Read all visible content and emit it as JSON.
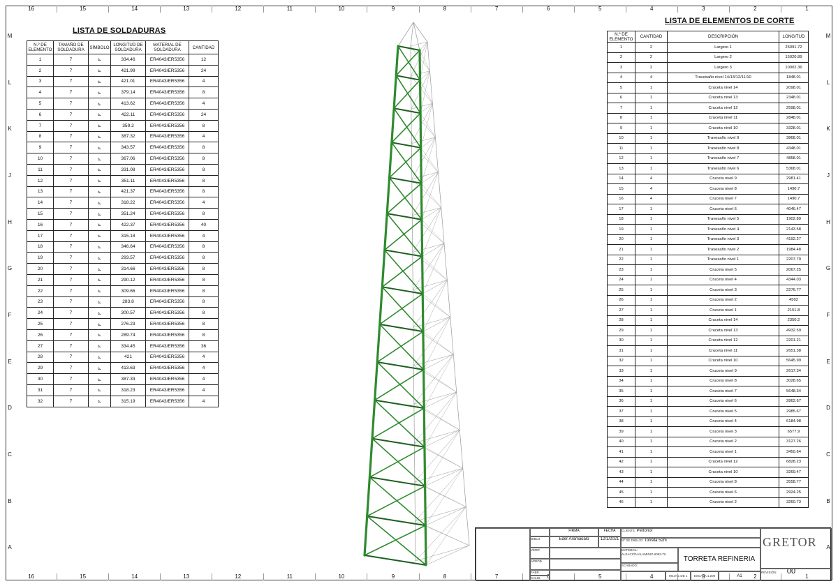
{
  "zones_top": [
    "16",
    "15",
    "14",
    "13",
    "12",
    "11",
    "10",
    "9",
    "8",
    "7",
    "6",
    "5",
    "4",
    "3",
    "2",
    "1"
  ],
  "zones_side": [
    "M",
    "L",
    "K",
    "J",
    "H",
    "G",
    "F",
    "E",
    "D",
    "C",
    "B",
    "A"
  ],
  "weld_list": {
    "title": "LISTA DE SOLDADURAS",
    "headers": [
      "N.º DE ELEMENTO",
      "TAMAÑO DE SOLDADURA",
      "SÍMBOLO",
      "LONGITUD DE SOLDADURA",
      "MATERIAL DE SOLDADURA",
      "CANTIDAD"
    ],
    "symbol": "⊾",
    "rows": [
      [
        "1",
        "7",
        "334.46",
        "ER4043/ER5356",
        "12"
      ],
      [
        "2",
        "7",
        "421.99",
        "ER4043/ER5356",
        "24"
      ],
      [
        "3",
        "7",
        "421.01",
        "ER4043/ER5356",
        "4"
      ],
      [
        "4",
        "7",
        "379.14",
        "ER4043/ER5356",
        "8"
      ],
      [
        "5",
        "7",
        "413.62",
        "ER4043/ER5356",
        "4"
      ],
      [
        "6",
        "7",
        "422.11",
        "ER4043/ER5356",
        "24"
      ],
      [
        "7",
        "7",
        "359.2",
        "ER4043/ER5356",
        "8"
      ],
      [
        "8",
        "7",
        "387.32",
        "ER4043/ER5356",
        "4"
      ],
      [
        "9",
        "7",
        "343.57",
        "ER4043/ER5356",
        "8"
      ],
      [
        "10",
        "7",
        "367.06",
        "ER4043/ER5356",
        "8"
      ],
      [
        "11",
        "7",
        "331.08",
        "ER4043/ER5356",
        "8"
      ],
      [
        "12",
        "7",
        "351.11",
        "ER4043/ER5356",
        "8"
      ],
      [
        "13",
        "7",
        "421.37",
        "ER4043/ER5356",
        "8"
      ],
      [
        "14",
        "7",
        "318.22",
        "ER4043/ER5356",
        "4"
      ],
      [
        "15",
        "7",
        "351.24",
        "ER4043/ER5356",
        "8"
      ],
      [
        "16",
        "7",
        "422.37",
        "ER4043/ER5356",
        "40"
      ],
      [
        "17",
        "7",
        "315.18",
        "ER4043/ER5356",
        "4"
      ],
      [
        "18",
        "7",
        "346.64",
        "ER4043/ER5356",
        "8"
      ],
      [
        "19",
        "7",
        "293.57",
        "ER4043/ER5356",
        "8"
      ],
      [
        "20",
        "7",
        "314.66",
        "ER4043/ER5356",
        "8"
      ],
      [
        "21",
        "7",
        "290.12",
        "ER4043/ER5356",
        "8"
      ],
      [
        "22",
        "7",
        "309.66",
        "ER4043/ER5356",
        "8"
      ],
      [
        "23",
        "7",
        "283.8",
        "ER4043/ER5356",
        "8"
      ],
      [
        "24",
        "7",
        "300.57",
        "ER4043/ER5356",
        "8"
      ],
      [
        "25",
        "7",
        "276.23",
        "ER4043/ER5356",
        "8"
      ],
      [
        "26",
        "7",
        "289.74",
        "ER4043/ER5356",
        "8"
      ],
      [
        "27",
        "7",
        "334.45",
        "ER4043/ER5356",
        "36"
      ],
      [
        "28",
        "7",
        "421",
        "ER4043/ER5356",
        "4"
      ],
      [
        "29",
        "7",
        "413.63",
        "ER4043/ER5356",
        "4"
      ],
      [
        "30",
        "7",
        "387.33",
        "ER4043/ER5356",
        "4"
      ],
      [
        "31",
        "7",
        "318.23",
        "ER4043/ER5356",
        "4"
      ],
      [
        "32",
        "7",
        "315.19",
        "ER4043/ER5356",
        "4"
      ]
    ]
  },
  "cut_list": {
    "title": "LISTA DE ELEMENTOS DE CORTE",
    "headers": [
      "N.º DE ELEMENTO",
      "CANTIDAD",
      "DESCRIPCIÓN",
      "LONGITUD"
    ],
    "rows": [
      [
        "1",
        "2",
        "Largero 1",
        "25091.72"
      ],
      [
        "2",
        "2",
        "Largero 2",
        "15020.89"
      ],
      [
        "3",
        "2",
        "Largero 3",
        "10002.36"
      ],
      [
        "4",
        "4",
        "Travesaño nivel 14/13/12/11/10",
        "1848.01"
      ],
      [
        "5",
        "1",
        "Cruceta nivel 14",
        "2098.01"
      ],
      [
        "6",
        "1",
        "Cruceta nivel 13",
        "2348.01"
      ],
      [
        "7",
        "1",
        "Cruceta nivel 12",
        "2598.01"
      ],
      [
        "8",
        "1",
        "Cruceta nivel 11",
        "2848.01"
      ],
      [
        "9",
        "1",
        "Cruceta nivel 10",
        "3328.01"
      ],
      [
        "10",
        "1",
        "Travesaño nivel 9",
        "3868.01"
      ],
      [
        "11",
        "1",
        "Travesaño nivel 8",
        "4348.01"
      ],
      [
        "12",
        "1",
        "Travesaño nivel 7",
        "4858.01"
      ],
      [
        "13",
        "1",
        "Travesaño nivel 6",
        "5368.01"
      ],
      [
        "14",
        "4",
        "Cruceta nivel 9",
        "2981.41"
      ],
      [
        "15",
        "4",
        "Cruceta nivel 8",
        "1490.7"
      ],
      [
        "16",
        "4",
        "Cruceta nivel 7",
        "1490.7"
      ],
      [
        "17",
        "1",
        "Cruceta nivel 6",
        "4046.47"
      ],
      [
        "18",
        "1",
        "Travesaño nivel 5",
        "1902.89"
      ],
      [
        "19",
        "1",
        "Travesaño nivel 4",
        "2143.58"
      ],
      [
        "20",
        "1",
        "Travesaño nivel 3",
        "4192.27"
      ],
      [
        "21",
        "1",
        "Travesaño nivel 2",
        "1984.48"
      ],
      [
        "22",
        "1",
        "Travesaño nivel 1",
        "2207.79"
      ],
      [
        "23",
        "1",
        "Cruceta nivel 5",
        "2067.25"
      ],
      [
        "24",
        "1",
        "Cruceta nivel 4",
        "4344.03"
      ],
      [
        "25",
        "1",
        "Cruceta nivel 3",
        "2276.77"
      ],
      [
        "26",
        "1",
        "Cruceta nivel 2",
        "4502"
      ],
      [
        "27",
        "1",
        "Cruceta nivel 1",
        "2151.8"
      ],
      [
        "28",
        "1",
        "Cruceta nivel 14",
        "2350.2"
      ],
      [
        "29",
        "1",
        "Cruceta nivel 13",
        "4932.59"
      ],
      [
        "30",
        "1",
        "Cruceta nivel 12",
        "2201.21"
      ],
      [
        "31",
        "1",
        "Cruceta nivel 11",
        "2651.38"
      ],
      [
        "32",
        "1",
        "Cruceta nivel 10",
        "5645.99"
      ],
      [
        "33",
        "1",
        "Cruceta nivel 9",
        "2617.34"
      ],
      [
        "34",
        "1",
        "Cruceta nivel 8",
        "3028.65"
      ],
      [
        "35",
        "1",
        "Cruceta nivel 7",
        "5648.34"
      ],
      [
        "36",
        "1",
        "Cruceta nivel 6",
        "2862.67"
      ],
      [
        "37",
        "1",
        "Cruceta nivel 5",
        "2985.67"
      ],
      [
        "38",
        "1",
        "Cruceta nivel 4",
        "6184.98"
      ],
      [
        "39",
        "1",
        "Cruceta nivel 3",
        "6577.9"
      ],
      [
        "40",
        "1",
        "Cruceta nivel 2",
        "3127.26"
      ],
      [
        "41",
        "1",
        "Cruceta nivel 1",
        "3450.64"
      ],
      [
        "42",
        "1",
        "Cruceta nivel 12",
        "6828.23"
      ],
      [
        "43",
        "1",
        "Cruceta nivel 10",
        "3269.47"
      ],
      [
        "44",
        "1",
        "Cruceta nivel 8",
        "3558.77"
      ],
      [
        "45",
        "1",
        "Cruceta nivel 6",
        "2924.25"
      ],
      [
        "46",
        "1",
        "Cruceta nivel 2",
        "3260.73"
      ]
    ]
  },
  "title_block": {
    "col_firma": "FIRMA",
    "col_fecha": "FECHA",
    "dibuj_label": "DIBUJ.",
    "dibuj_name": "Eder Aramaoalo",
    "dibuj_date": "12/1/2021",
    "verif_label": "VERIF.",
    "aprob_label": "APROB.",
    "fabr_label": "FABR.",
    "calid_label": "CALID.",
    "cliente_label": "CLIENTE:",
    "cliente_value": "Petronor",
    "dibujo_label": "Nº DE DIBUJO:",
    "dibujo_value": "Torreta 52m",
    "material_label": "MATERIAL:",
    "material_value": "ALEACIÓN ALUMINIO 6082-T6",
    "acabado_label": "ACABADO:",
    "title": "TORRETA REFINERIA",
    "hoja_label": "HOJA 1 DE 1",
    "escala_label": "ESCALA:1:200",
    "size": "A1",
    "revision_label": "REVISIÓN",
    "revision_value": "00",
    "logo_text": "GRETOR"
  },
  "colors": {
    "member_green": "#2e8b2e",
    "member_dark": "#1f5f1f",
    "wire_grey": "#9a9a9a"
  }
}
